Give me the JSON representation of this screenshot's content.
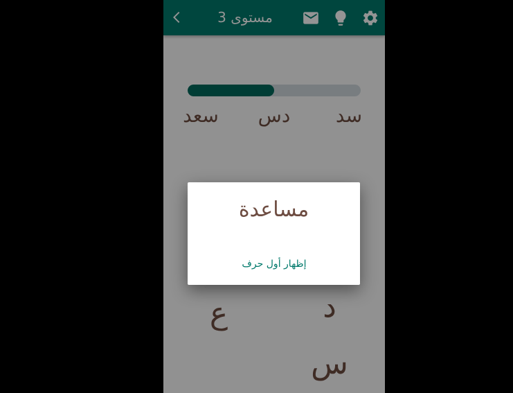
{
  "app": {
    "title": "مستوى 3",
    "icons": [
      "back-arrow-icon",
      "mail-icon",
      "lightbulb-icon",
      "settings-gear-icon"
    ],
    "colors": {
      "app_bar": "#00796b",
      "progress_fill": "#00695c",
      "progress_track": "#cfd8dc",
      "word_text": "#6d4c41",
      "dialog_button": "#00796b"
    }
  },
  "game": {
    "progress_fraction": 0.5,
    "found_words": [
      "سد",
      "دس",
      "سعد"
    ],
    "letters": [
      "ع",
      "د",
      "س"
    ]
  },
  "dialog": {
    "title": "مساعدة",
    "button": "إظهار أول حرف"
  }
}
